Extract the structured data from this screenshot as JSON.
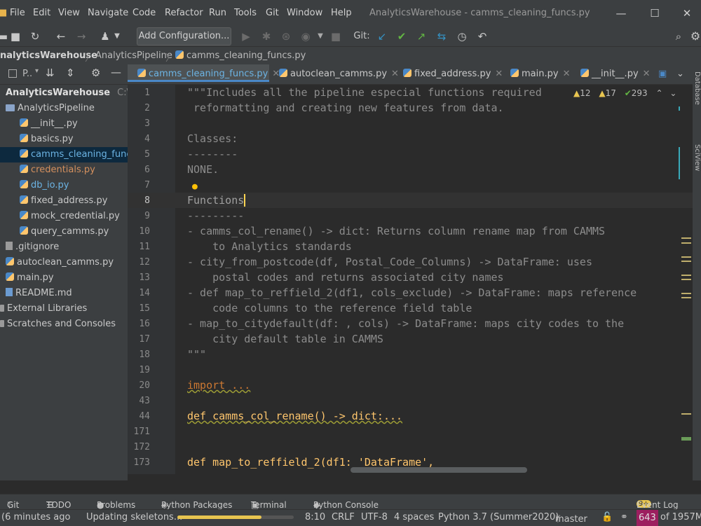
{
  "window": {
    "title": "AnalyticsWarehouse - camms_cleaning_funcs.py",
    "minimize": "—",
    "maximize": "☐",
    "close": "✕"
  },
  "menu": {
    "items": [
      "File",
      "Edit",
      "View",
      "Navigate",
      "Code",
      "Refactor",
      "Run",
      "Tools",
      "Git",
      "Window",
      "Help"
    ]
  },
  "toolbar": {
    "add_configuration": "Add Configuration...",
    "git_label": "Git:"
  },
  "breadcrumb": {
    "items": [
      "nalyticsWarehouse",
      "AnalyticsPipeline",
      "camms_cleaning_funcs.py"
    ],
    "separator": "〉"
  },
  "project": {
    "view_label": "P..",
    "root": "AnalyticsWarehouse",
    "root_path": "C:\\Sam",
    "items": [
      {
        "label": "AnalyticsPipeline",
        "kind": "folder",
        "indent": 1
      },
      {
        "label": "__init__.py",
        "kind": "py",
        "indent": 2
      },
      {
        "label": "basics.py",
        "kind": "py",
        "indent": 2
      },
      {
        "label": "camms_cleaning_funcs.",
        "kind": "py",
        "indent": 2,
        "selected": true
      },
      {
        "label": "credentials.py",
        "kind": "py",
        "indent": 2,
        "color": "#d4905e"
      },
      {
        "label": "db_io.py",
        "kind": "py",
        "indent": 2,
        "color": "#6cb4e4"
      },
      {
        "label": "fixed_address.py",
        "kind": "py",
        "indent": 2
      },
      {
        "label": "mock_credential.py",
        "kind": "py",
        "indent": 2
      },
      {
        "label": "query_camms.py",
        "kind": "py",
        "indent": 2
      },
      {
        "label": ".gitignore",
        "kind": "file",
        "indent": 1
      },
      {
        "label": "autoclean_camms.py",
        "kind": "py",
        "indent": 1
      },
      {
        "label": "main.py",
        "kind": "py",
        "indent": 1
      },
      {
        "label": "README.md",
        "kind": "file",
        "indent": 1
      },
      {
        "label": "External Libraries",
        "kind": "lib",
        "indent": 0
      },
      {
        "label": "Scratches and Consoles",
        "kind": "lib",
        "indent": 0
      }
    ]
  },
  "tabs": [
    {
      "label": "camms_cleaning_funcs.py",
      "active": true
    },
    {
      "label": "autoclean_camms.py"
    },
    {
      "label": "fixed_address.py"
    },
    {
      "label": "main.py"
    },
    {
      "label": "__init__.py"
    }
  ],
  "inspections": {
    "warnings": "12",
    "weak": "17",
    "ok": "293"
  },
  "editor": {
    "line_numbers": [
      "1",
      "2",
      "3",
      "4",
      "5",
      "6",
      "7",
      "8",
      "9",
      "10",
      "11",
      "12",
      "13",
      "14",
      "15",
      "16",
      "17",
      "18",
      "19",
      "20",
      "43",
      "44",
      "171",
      "172",
      "173"
    ],
    "lines": [
      "\"\"\"Includes all the pipeline especial functions required",
      " reformatting and creating new features from data.",
      "",
      "Classes:",
      "--------",
      "NONE.",
      "",
      "Functions",
      "---------",
      "- camms_col_rename() -> dict: Returns column rename map from CAMMS",
      "    to Analytics standards",
      "- city_from_postcode(df, Postal_Code_Columns) -> DataFrame: uses",
      "    postal codes and returns associated city names",
      "- def map_to_reffield_2(df1, cols_exclude) -> DataFrame: maps reference",
      "    code columns to the reference field table",
      "- map_to_citydefault(df: , cols) -> DataFrame: maps city codes to the",
      "    city default table in CAMMS",
      "\"\"\"",
      "",
      "import ...",
      "",
      "def camms_col_rename() -> dict:...",
      "",
      "",
      "def map_to_reffield_2(df1: 'DataFrame',"
    ]
  },
  "bottom_tools": [
    "Git",
    "TODO",
    "Problems",
    "Python Packages",
    "Terminal",
    "Python Console",
    "Event Log"
  ],
  "event_log_count": "9+",
  "status": {
    "left": "(6 minutes ago",
    "task": "Updating skeletons...",
    "task_progress": 0.72,
    "position": "8:10",
    "line_sep": "CRLF",
    "encoding": "UTF-8",
    "indent": "4 spaces",
    "interpreter": "Python 3.7 (Summer2020)",
    "branch": "master",
    "memory_used": "643",
    "memory_total": "of 1957M"
  },
  "right_strip": {
    "database": "Database",
    "sciview": "SciView"
  }
}
